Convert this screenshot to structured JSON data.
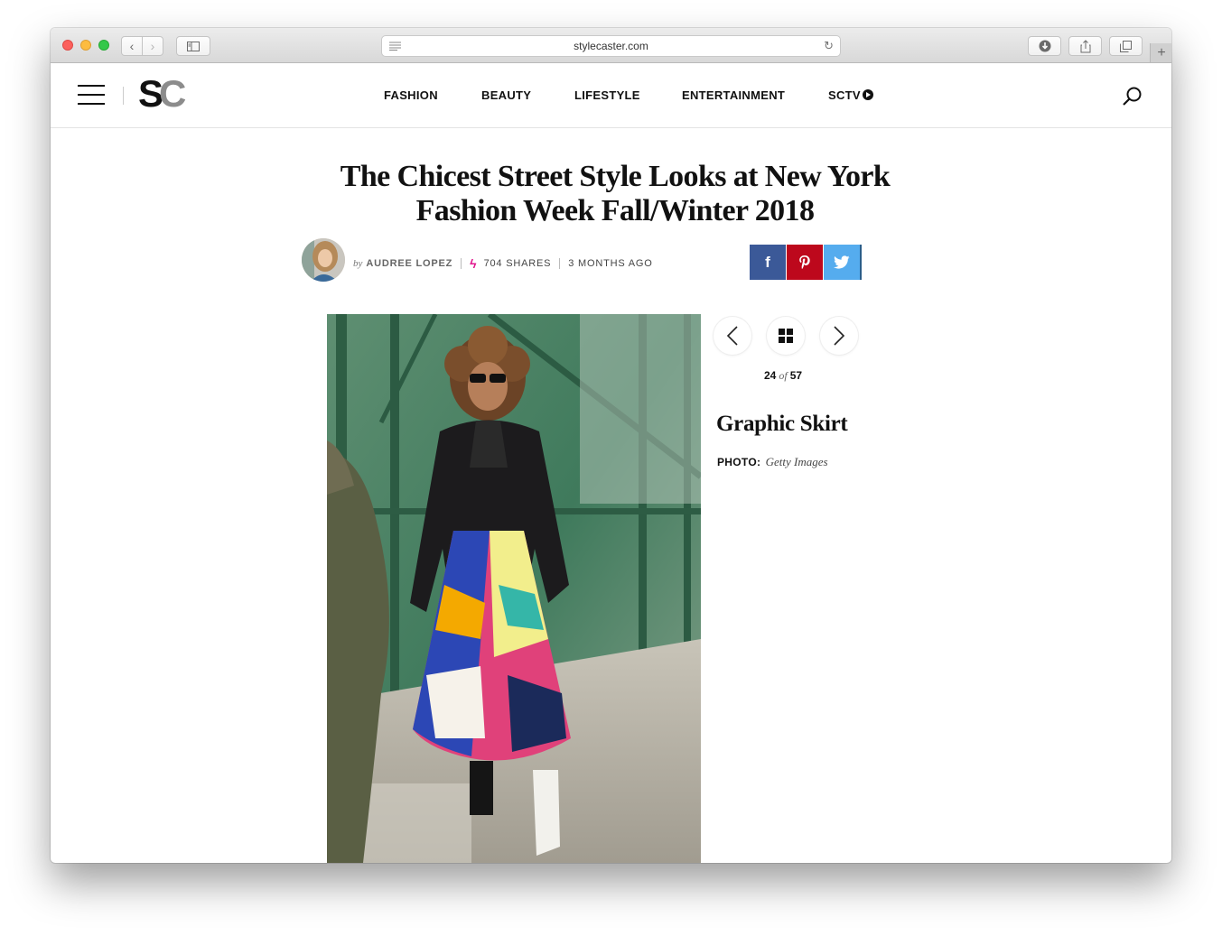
{
  "browser": {
    "url": "stylecaster.com",
    "buttons": {
      "back": "‹",
      "forward": "›",
      "reload": "↻",
      "new_tab": "+"
    }
  },
  "site": {
    "logo_s": "S",
    "logo_c": "C",
    "nav": [
      "FASHION",
      "BEAUTY",
      "LIFESTYLE",
      "ENTERTAINMENT",
      "SCTV"
    ]
  },
  "article": {
    "title": "The Chicest Street Style Looks at New York Fashion Week Fall/Winter 2018",
    "by": "by",
    "author": "AUDREE LOPEZ",
    "shares": "704 SHARES",
    "posted": "3 MONTHS AGO",
    "share_buttons": [
      {
        "network": "facebook",
        "glyph": "f",
        "color": "#3b5998"
      },
      {
        "network": "pinterest",
        "glyph": "P",
        "color": "#bd081c"
      },
      {
        "network": "twitter",
        "glyph": "twitter-bird-icon",
        "color": "#55acee"
      }
    ]
  },
  "gallery": {
    "current": "24",
    "of": "of",
    "total": "57",
    "slide_title": "Graphic Skirt",
    "credit_label": "PHOTO:",
    "credit_source": "Getty Images"
  },
  "colors": {
    "accent_bolt": "#e0148c",
    "facebook": "#3b5998",
    "pinterest": "#bd081c",
    "twitter": "#55acee"
  }
}
